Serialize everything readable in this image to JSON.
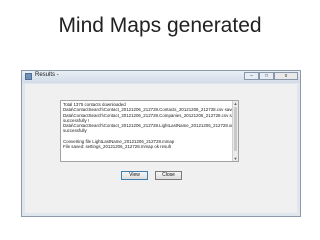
{
  "slide": {
    "title": "Mind Maps generated"
  },
  "window": {
    "title": "Results -",
    "controls": {
      "minimize": "–",
      "maximize": "□",
      "close": "x"
    }
  },
  "log": {
    "lines": [
      "Total 1375 contacts downloaded",
      "Data\\ContactSearch\\Contact_20121206_212728.Contacts_20121206_212728.csv saved successfully !",
      "Data\\ContactSearch\\Contact_20121206_212728.Companies_20121206_212728.csv saved",
      "successfully !",
      "Data\\ContactSearch\\Contact_20121206_212728.LightLastName_20121206_212728.xml saved",
      "successfully",
      "",
      "Converting file LightLastName_20121206_212728.mmap",
      "File saved: settings_20121206_212728.mmap ok result"
    ]
  },
  "buttons": {
    "view": "View",
    "close": "Close"
  }
}
